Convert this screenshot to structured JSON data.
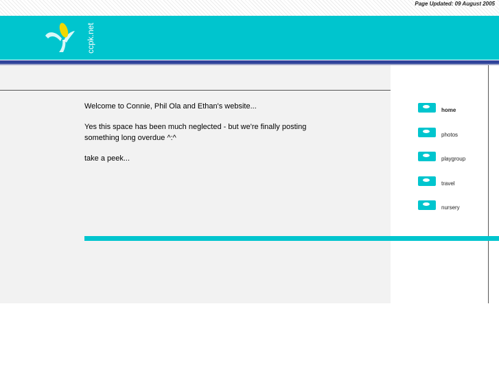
{
  "header": {
    "updated": "Page Updated: 09 August 2005",
    "logo_text": "ccpk.net"
  },
  "main": {
    "paragraphs": [
      "Welcome to Connie, Phil Ola and Ethan's website...",
      "Yes this space has been much neglected - but we're finally posting something long overdue ^:^",
      "take a peek..."
    ]
  },
  "nav": {
    "items": [
      {
        "label": "home",
        "icon": "bullet-icon",
        "active": true
      },
      {
        "label": "photos",
        "icon": "bullet-icon"
      },
      {
        "label": "playgroup",
        "icon": "bullet-icon"
      },
      {
        "label": "travel",
        "icon": "bullet-icon"
      },
      {
        "label": "nursery",
        "icon": "bullet-icon"
      }
    ]
  },
  "colors": {
    "teal": "#00c5ce",
    "navy": "#30449b",
    "logo_yellow": "#f2d800",
    "content_grey": "#f2f2f2"
  }
}
